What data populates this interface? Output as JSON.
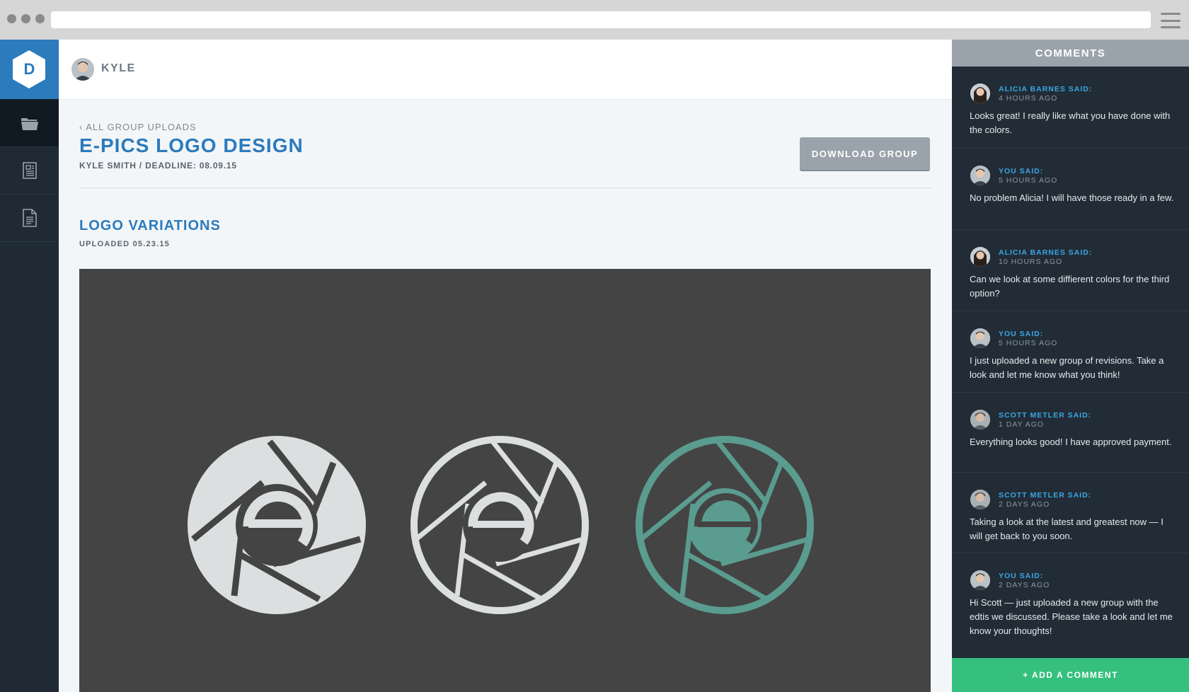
{
  "app": {
    "logo_letter": "D",
    "user_name": "KYLE"
  },
  "page": {
    "back_link": "‹ ALL GROUP UPLOADS",
    "title": "E-PICS LOGO DESIGN",
    "subtitle": "KYLE SMITH / DEADLINE: 08.09.15",
    "download_label": "DOWNLOAD GROUP",
    "section_title": "LOGO VARIATIONS",
    "section_subtitle": "UPLOADED 05.23.15"
  },
  "colors": {
    "brand_blue": "#2b7bbd",
    "link_blue": "#3ba6e6",
    "accent_green": "#35c07e",
    "logo_teal": "#5a9c8f",
    "logo_light": "#dcdfdf",
    "canvas_bg": "#444444",
    "sidebar_dark": "#1f2a35"
  },
  "sidebar": {
    "items": [
      {
        "icon": "folder-icon"
      },
      {
        "icon": "document-icon"
      },
      {
        "icon": "file-icon"
      }
    ]
  },
  "comments": {
    "header": "COMMENTS",
    "add_label": "+ ADD A COMMENT",
    "items": [
      {
        "author": "ALICIA BARNES SAID:",
        "time": "4 HOURS AGO",
        "text": "Looks great! I really like what you have done with the colors."
      },
      {
        "author": "YOU SAID:",
        "time": "5 HOURS AGO",
        "text": "No problem Alicia! I will have those ready in a few."
      },
      {
        "author": "ALICIA BARNES SAID:",
        "time": "10 HOURS AGO",
        "text": "Can we look at some diffierent colors for the third option?"
      },
      {
        "author": "YOU SAID:",
        "time": "5 HOURS AGO",
        "text": "I just uploaded a new group of revisions. Take a look and let me know what you think!"
      },
      {
        "author": "SCOTT METLER SAID:",
        "time": "1 DAY AGO",
        "text": "Everything looks good! I have approved payment."
      },
      {
        "author": "SCOTT METLER SAID:",
        "time": "2 DAYS AGO",
        "text": "Taking a look at the latest and greatest now — I will get back to you soon."
      },
      {
        "author": "YOU SAID:",
        "time": "2 DAYS AGO",
        "text": "Hi Scott — just uploaded a new group with the edtis we discussed. Please take a look and let me know your thoughts!"
      }
    ]
  }
}
